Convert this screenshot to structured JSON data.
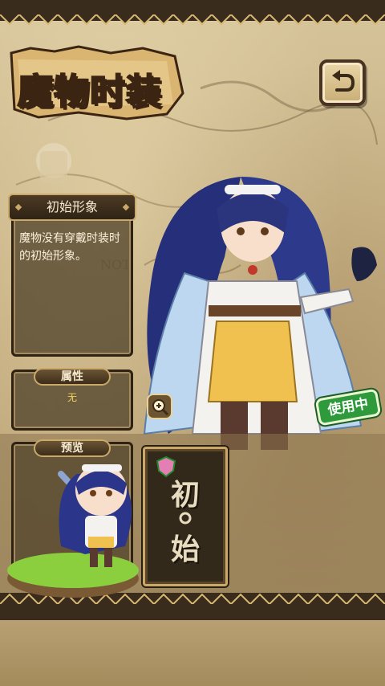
{
  "screen": {
    "title": "魔物时装",
    "back_button_icon": "return-arrow-icon"
  },
  "costume_info": {
    "name": "初始形象",
    "description": "魔物没有穿戴时装时的初始形象。",
    "attribute_label": "属性",
    "attribute_value": "无",
    "preview_label": "预览",
    "in_use_badge": "使用中",
    "zoom_icon": "magnify-plus-icon"
  },
  "costume_list": [
    {
      "card_text_top": "初",
      "card_text_bottom": "始"
    }
  ],
  "colors": {
    "frame_dark": "#3a2c1c",
    "gold_trim": "#c9a86a",
    "badge_green": "#2f9a3b",
    "attr_value": "#f2d060"
  }
}
